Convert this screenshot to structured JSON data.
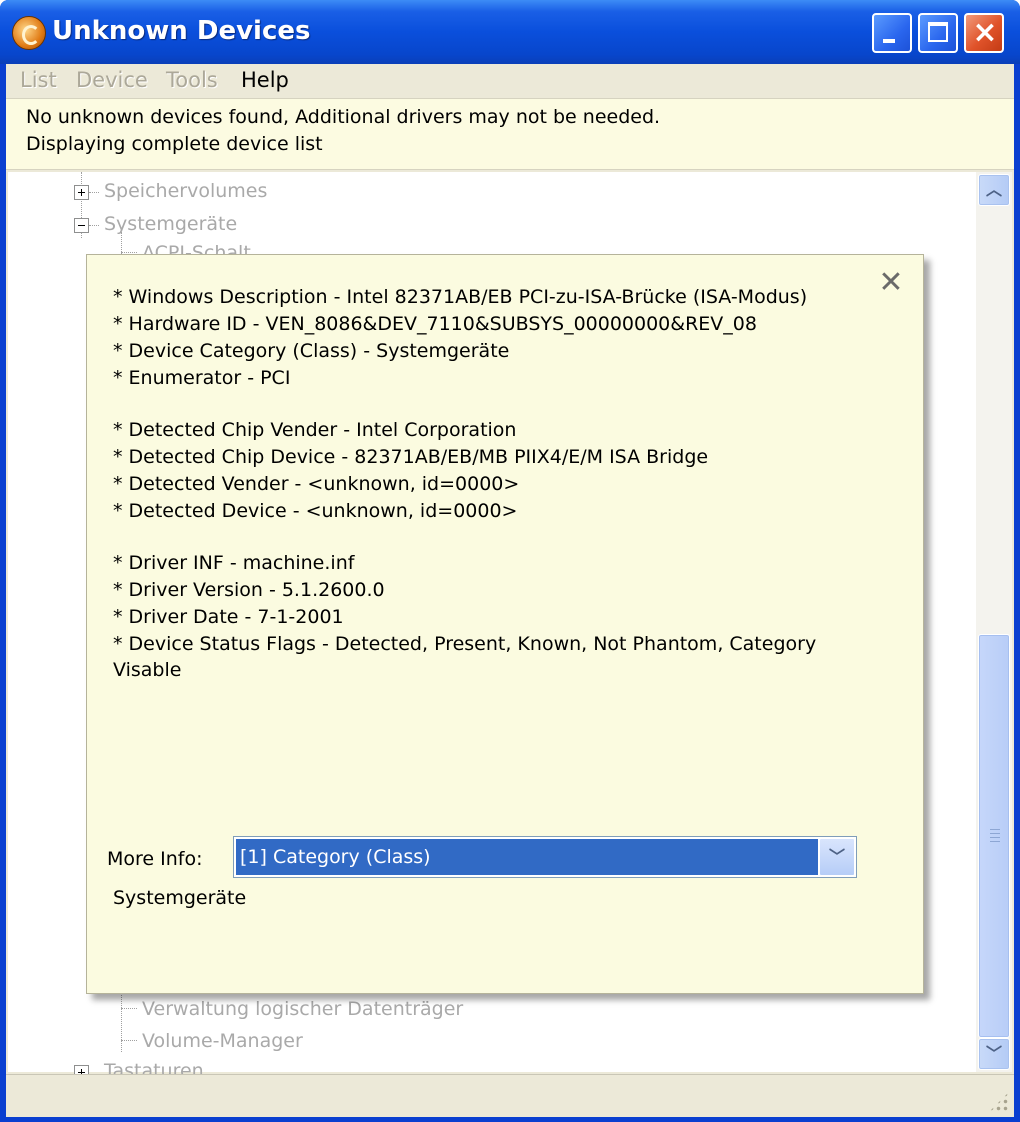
{
  "window": {
    "title": "Unknown Devices",
    "icon": "app-icon",
    "buttons": [
      "minimize-icon",
      "maximize-icon",
      "close-icon"
    ]
  },
  "menu": {
    "list": "List",
    "device": "Device",
    "tools": "Tools",
    "help": "Help"
  },
  "banner": {
    "line1": "No unknown devices found, Additional drivers may not be needed.",
    "line2": "Displaying complete device list"
  },
  "tree": {
    "item_speichervolumes": "Speichervolumes",
    "item_systemgeraete": "Systemgeräte",
    "item_acpi_partial": "ACPI-Schalt",
    "item_verwaltung": "Verwaltung logischer Datenträger",
    "item_volume_manager": "Volume-Manager",
    "item_tastaturen_partial": "Tastaturen"
  },
  "popup": {
    "close_symbol": "✕",
    "details": [
      "* Windows Description - Intel 82371AB/EB PCI-zu-ISA-Brücke (ISA-Modus)",
      "* Hardware ID - VEN_8086&DEV_7110&SUBSYS_00000000&REV_08",
      "* Device Category (Class) - Systemgeräte",
      "* Enumerator - PCI",
      "* Detected Chip Vender - Intel Corporation",
      "* Detected Chip Device - 82371AB/EB/MB PIIX4/E/M ISA Bridge",
      "* Detected Vender - <unknown, id=0000>",
      "* Detected Device - <unknown, id=0000>",
      "* Driver INF - machine.inf",
      "* Driver Version - 5.1.2600.0",
      "* Driver Date - 7-1-2001",
      "* Device Status Flags - Detected, Present, Known, Not Phantom, Category",
      "Visable"
    ],
    "more_info_label": "More Info:",
    "more_info_selected": "[1] Category (Class)",
    "more_info_value": "Systemgeräte"
  },
  "colors": {
    "titlebar": "#0a4fdc",
    "popup_bg": "#fbfbe0",
    "selection": "#316ac5",
    "menu_disabled": "#aca899"
  }
}
